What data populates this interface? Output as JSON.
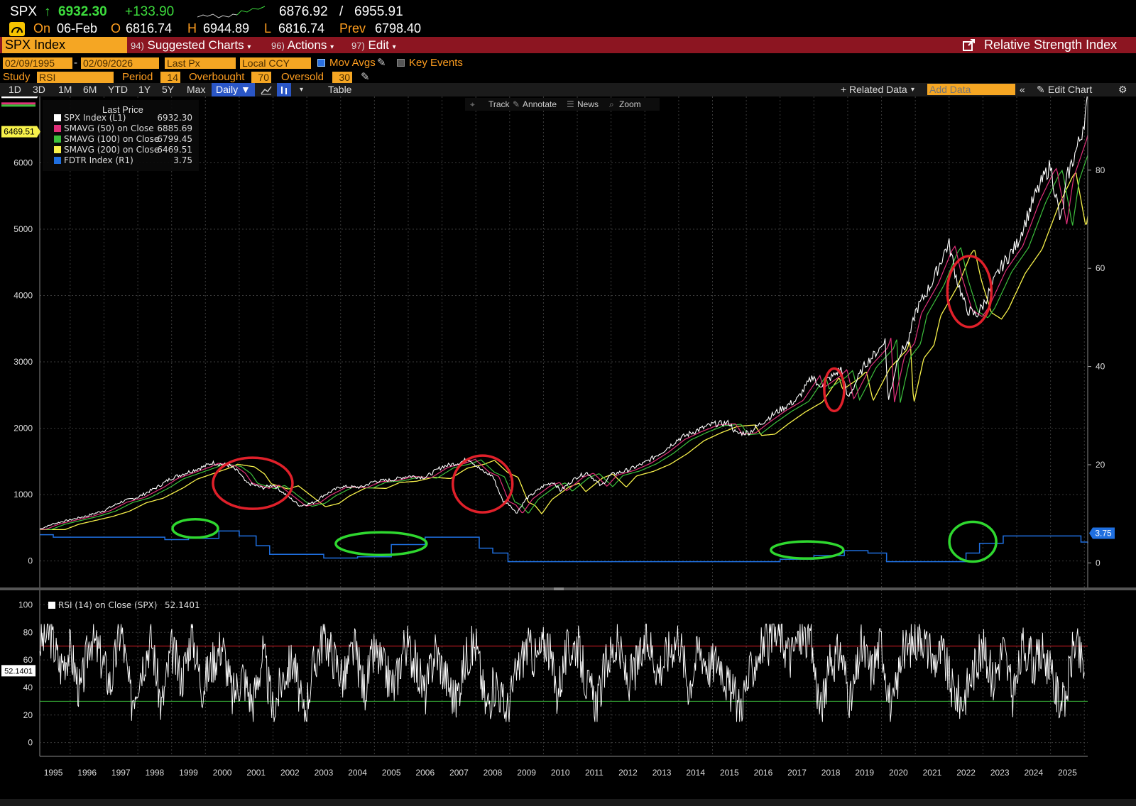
{
  "header": {
    "ticker": "SPX",
    "arrow": "↑",
    "last": "6932.30",
    "change": "+133.90",
    "bid": "6876.92",
    "slash": "/",
    "ask": "6955.91",
    "on_label": "On",
    "date": "06-Feb",
    "o_label": "O",
    "open": "6816.74",
    "h_label": "H",
    "high": "6944.89",
    "l_label": "L",
    "low": "6816.74",
    "prev_label": "Prev",
    "prev": "6798.40"
  },
  "menubar": {
    "security": "SPX Index",
    "suggested_num": "94)",
    "suggested": "Suggested Charts",
    "actions_num": "96)",
    "actions": "Actions",
    "edit_num": "97)",
    "edit": "Edit",
    "title": "Relative Strength Index"
  },
  "controls": {
    "start_date": "02/09/1995",
    "dash": "-",
    "end_date": "02/09/2026",
    "price_type": "Last Px",
    "currency": "Local CCY",
    "mov_avgs": "Mov Avgs",
    "key_events": "Key Events",
    "study_label": "Study",
    "study": "RSI",
    "period_label": "Period",
    "period": "14",
    "overbought_label": "Overbought",
    "overbought": "70",
    "oversold_label": "Oversold",
    "oversold": "30"
  },
  "toolbar": {
    "ranges": [
      "1D",
      "3D",
      "1M",
      "6M",
      "YTD",
      "1Y",
      "5Y",
      "Max"
    ],
    "frequency": "Daily",
    "table": "Table",
    "related_data": "Related Data",
    "add_data_placeholder": "Add Data",
    "edit_chart": "Edit Chart"
  },
  "chart_toolbar": {
    "track": "Track",
    "annotate": "Annotate",
    "news": "News",
    "zoom": "Zoom"
  },
  "chart_data": [
    {
      "type": "line",
      "legend_title": "Last Price",
      "legend_position": "top-left",
      "grid": true,
      "xticks": [
        "1995",
        "1996",
        "1997",
        "1998",
        "1999",
        "2000",
        "2001",
        "2002",
        "2003",
        "2004",
        "2005",
        "2006",
        "2007",
        "2008",
        "2009",
        "2010",
        "2011",
        "2012",
        "2013",
        "2014",
        "2015",
        "2016",
        "2017",
        "2018",
        "2019",
        "2020",
        "2021",
        "2022",
        "2023",
        "2024",
        "2025"
      ],
      "xlim": [
        1995.1,
        2026.1
      ],
      "ylim_left": [
        -400,
        7000
      ],
      "yticks_left": [
        0,
        1000,
        2000,
        3000,
        4000,
        5000,
        6000
      ],
      "ylim_right": [
        -5,
        95
      ],
      "yticks_right": [
        0,
        20,
        40,
        60,
        80
      ],
      "left_axis_badges": [
        {
          "value": 6932.3,
          "label": "6932.30",
          "color": "#ffffff"
        },
        {
          "value": 6469.51,
          "label": "6469.51",
          "color": "#f7f14a"
        }
      ],
      "right_axis_badge": {
        "value": 3.75,
        "label": "3.75",
        "color": "#1f6fe0"
      },
      "series": [
        {
          "name": "SPX Index (L1)",
          "legend_value": "6932.30",
          "color": "#ffffff",
          "axis": "left",
          "x": [
            1995.1,
            1995.5,
            1996.0,
            1996.5,
            1997.0,
            1997.5,
            1998.0,
            1998.6,
            1999.0,
            1999.5,
            2000.0,
            2000.2,
            2000.7,
            2001.0,
            2001.2,
            2001.7,
            2002.0,
            2002.5,
            2002.8,
            2003.2,
            2003.5,
            2004.0,
            2004.6,
            2005.0,
            2005.5,
            2006.0,
            2006.5,
            2007.0,
            2007.5,
            2007.8,
            2008.2,
            2008.5,
            2008.8,
            2009.0,
            2009.2,
            2009.5,
            2010.0,
            2010.3,
            2010.5,
            2011.0,
            2011.3,
            2011.7,
            2012.0,
            2012.5,
            2013.0,
            2013.5,
            2014.0,
            2014.5,
            2015.0,
            2015.5,
            2015.7,
            2016.1,
            2016.5,
            2017.0,
            2017.5,
            2018.0,
            2018.1,
            2018.6,
            2018.8,
            2019.0,
            2019.5,
            2020.0,
            2020.1,
            2020.2,
            2020.5,
            2020.8,
            2021.0,
            2021.5,
            2021.9,
            2022.0,
            2022.2,
            2022.5,
            2022.8,
            2023.0,
            2023.5,
            2024.0,
            2024.5,
            2024.9,
            2025.0,
            2025.3,
            2025.5,
            2025.9,
            2026.1
          ],
          "y": [
            480,
            560,
            620,
            680,
            760,
            890,
            960,
            1120,
            1250,
            1340,
            1430,
            1480,
            1440,
            1330,
            1180,
            1100,
            1150,
            950,
            830,
            880,
            990,
            1120,
            1110,
            1200,
            1220,
            1280,
            1260,
            1420,
            1480,
            1540,
            1350,
            1280,
            900,
            850,
            720,
            940,
            1130,
            1190,
            1060,
            1270,
            1330,
            1130,
            1300,
            1370,
            1480,
            1640,
            1840,
            1960,
            2060,
            2080,
            1920,
            1940,
            2100,
            2280,
            2430,
            2810,
            2620,
            2800,
            2900,
            2450,
            2950,
            3230,
            3380,
            2400,
            3100,
            3300,
            3750,
            4200,
            4700,
            4770,
            4300,
            3800,
            3700,
            3850,
            4400,
            4770,
            5450,
            5880,
            5950,
            5100,
            5800,
            6400,
            6932
          ]
        },
        {
          "name": "SMAVG (50) on Close",
          "legend_value": "6885.69",
          "color": "#e0307a",
          "axis": "left"
        },
        {
          "name": "SMAVG (100) on Close",
          "legend_value": "6799.45",
          "color": "#3cbf3c",
          "axis": "left"
        },
        {
          "name": "SMAVG (200) on Close",
          "legend_value": "6469.51",
          "color": "#f7f14a",
          "axis": "left"
        },
        {
          "name": "FDTR Index (R1)",
          "legend_value": "3.75",
          "color": "#1f6fe0",
          "axis": "right",
          "x": [
            1995.1,
            1995.5,
            1998.8,
            1999.5,
            2000.4,
            2001.0,
            2001.5,
            2001.9,
            2003.5,
            2004.5,
            2005.5,
            2006.5,
            2007.7,
            2008.1,
            2008.5,
            2008.95,
            2015.95,
            2017.0,
            2018.0,
            2018.9,
            2019.6,
            2020.15,
            2022.2,
            2022.5,
            2022.9,
            2023.6,
            2024.7,
            2025.9,
            2026.1
          ],
          "y": [
            5.75,
            5.25,
            4.75,
            5.0,
            6.5,
            5.5,
            3.5,
            1.75,
            1.0,
            1.25,
            3.75,
            5.25,
            5.25,
            3.0,
            2.0,
            0.25,
            0.25,
            0.75,
            1.5,
            2.5,
            2.0,
            0.25,
            0.25,
            2.0,
            4.0,
            5.5,
            5.5,
            4.25,
            4.0
          ]
        }
      ],
      "annotations": [
        {
          "shape": "ellipse",
          "color": "#e0202a",
          "cx": 2001.4,
          "cy": 1170
        },
        {
          "shape": "ellipse",
          "color": "#e0202a",
          "cx": 2008.2,
          "cy": 1160
        },
        {
          "shape": "ellipse",
          "color": "#e0202a",
          "cx": 2018.6,
          "cy": 2580
        },
        {
          "shape": "ellipse",
          "color": "#e0202a",
          "cx": 2022.6,
          "cy": 4060
        },
        {
          "shape": "ellipse",
          "color": "#2fd82f",
          "cx": 1999.7,
          "cy": 490
        },
        {
          "shape": "ellipse",
          "color": "#2fd82f",
          "cx": 2005.2,
          "cy": 260
        },
        {
          "shape": "ellipse",
          "color": "#2fd82f",
          "cx": 2017.8,
          "cy": 165
        },
        {
          "shape": "ellipse",
          "color": "#2fd82f",
          "cx": 2022.7,
          "cy": 290
        }
      ]
    },
    {
      "type": "line",
      "legend_position": "top-left",
      "ylim": [
        -10,
        110
      ],
      "yticks": [
        0,
        20,
        40,
        60,
        80,
        100
      ],
      "overbought": 70,
      "oversold": 30,
      "current_badge": {
        "value": 52.1401,
        "label": "52.1401"
      },
      "series": [
        {
          "name": "RSI (14) on Close (SPX)",
          "legend_value": "52.1401",
          "color": "#ffffff",
          "x": [
            1995.1,
            1995.4,
            1995.7,
            1996.0,
            1996.3,
            1996.6,
            1996.9,
            1997.2,
            1997.5,
            1997.8,
            1998.1,
            1998.4,
            1998.7,
            1999.0,
            1999.3,
            1999.6,
            1999.9,
            2000.2,
            2000.5,
            2000.8,
            2001.1,
            2001.4,
            2001.7,
            2002.0,
            2002.3,
            2002.6,
            2002.9,
            2003.2,
            2003.5,
            2003.8,
            2004.1,
            2004.4,
            2004.7,
            2005.0,
            2005.3,
            2005.6,
            2005.9,
            2006.2,
            2006.5,
            2006.8,
            2007.1,
            2007.4,
            2007.7,
            2008.0,
            2008.3,
            2008.6,
            2008.9,
            2009.2,
            2009.5,
            2009.8,
            2010.1,
            2010.4,
            2010.7,
            2011.0,
            2011.3,
            2011.6,
            2011.9,
            2012.2,
            2012.5,
            2012.8,
            2013.1,
            2013.4,
            2013.7,
            2014.0,
            2014.3,
            2014.6,
            2014.9,
            2015.2,
            2015.5,
            2015.8,
            2016.1,
            2016.4,
            2016.7,
            2017.0,
            2017.3,
            2017.6,
            2017.9,
            2018.2,
            2018.5,
            2018.8,
            2019.1,
            2019.4,
            2019.7,
            2020.0,
            2020.3,
            2020.6,
            2020.9,
            2021.2,
            2021.5,
            2021.8,
            2022.1,
            2022.4,
            2022.7,
            2023.0,
            2023.3,
            2023.6,
            2023.9,
            2024.2,
            2024.5,
            2024.8,
            2025.1,
            2025.4,
            2025.7,
            2026.0
          ],
          "y": [
            72,
            80,
            55,
            68,
            35,
            78,
            62,
            42,
            84,
            30,
            55,
            76,
            25,
            68,
            46,
            80,
            40,
            58,
            72,
            33,
            50,
            28,
            65,
            22,
            48,
            60,
            18,
            55,
            78,
            62,
            45,
            70,
            38,
            66,
            52,
            40,
            74,
            58,
            35,
            68,
            48,
            30,
            62,
            72,
            25,
            45,
            20,
            50,
            70,
            60,
            75,
            35,
            66,
            72,
            40,
            28,
            62,
            70,
            44,
            58,
            74,
            52,
            66,
            78,
            40,
            70,
            55,
            62,
            38,
            26,
            48,
            68,
            72,
            80,
            62,
            78,
            74,
            22,
            58,
            66,
            28,
            70,
            52,
            74,
            20,
            64,
            72,
            80,
            58,
            66,
            38,
            30,
            52,
            68,
            44,
            70,
            30,
            72,
            56,
            66,
            40,
            25,
            74,
            52
          ]
        }
      ],
      "xticks": [
        "1995",
        "1996",
        "1997",
        "1998",
        "1999",
        "2000",
        "2001",
        "2002",
        "2003",
        "2004",
        "2005",
        "2006",
        "2007",
        "2008",
        "2009",
        "2010",
        "2011",
        "2012",
        "2013",
        "2014",
        "2015",
        "2016",
        "2017",
        "2018",
        "2019",
        "2020",
        "2021",
        "2022",
        "2023",
        "2024",
        "2025"
      ]
    }
  ]
}
